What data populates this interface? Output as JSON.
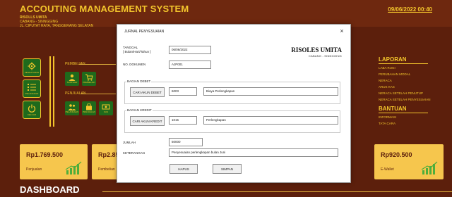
{
  "app": {
    "title": "ACCOUTING MANAGEMENT SYSTEM",
    "datetime": "09/06/2022 00:40",
    "business_name": "RISOLLS UMITA",
    "business_line2": "CABANG - SINNGGING",
    "business_address": "JL. CIPUTAT RAYA, TANGGERANG SELATAN"
  },
  "left_buttons": [
    {
      "label": "PENGATURAN"
    },
    {
      "label": "PELANGGAN"
    },
    {
      "label": "KELUAR"
    }
  ],
  "sections": {
    "pembelian": "PEMBELIAN",
    "penjualan": "PENJUALAN",
    "pembelian_items": [
      "SUPPLIER",
      "PEMBELIAN"
    ],
    "penjualan_items": [
      "PELANGGAN",
      "PENJUALAN",
      "KAS"
    ]
  },
  "right_panel": {
    "laporan_header": "LAPORAN",
    "laporan_items": [
      "LABA RUGI",
      "PERUBAHAN MODAL",
      "NERACA",
      "ARUS KAS",
      "NERACA SETELAH PENUTUP",
      "NERACA SETELAH PENYESUAIAN"
    ],
    "bantuan_header": "BANTUAN",
    "bantuan_items": [
      "INFORMASI",
      "TATA CARA"
    ]
  },
  "cards": [
    {
      "amount": "Rp1.769.500",
      "label": "Penjualan"
    },
    {
      "amount": "Rp2.852",
      "label": "Pembelian"
    },
    {
      "amount": "Rp920.500",
      "label": "E-Wallet"
    }
  ],
  "dashboard_title": "DASHBOARD",
  "dialog": {
    "title": "JURNAL PENYESUAIAN",
    "close": "×",
    "company_name": "RISOLES UMITA",
    "company_branch": "CABANG - SINNGGING",
    "tanggal_label": "TANGGAL",
    "tanggal_format": "[ Bulan/Hari/Tahun ]",
    "tanggal_value": "06/06/2022",
    "dokumen_label": "NO. DOKUMEN",
    "dokumen_value": "AJP001",
    "debet_group": "BAGIAN DEBET",
    "debet_button": "CARI AKUN DEBET",
    "debet_code": "6003",
    "debet_name": "Biaya Perlengkapan",
    "kredit_group": "BAGIAN KREDIT",
    "kredit_button": "CARI AKUN KREDIT",
    "kredit_code": "1015",
    "kredit_name": "Perlengkapan",
    "jumlah_label": "JUMLAH",
    "jumlah_value": "50000",
    "keterangan_label": "KETERANGAN",
    "keterangan_value": "Penyesuaian perlengkapan bulan Juni",
    "hapus_button": "HAPUS",
    "simpan_button": "SIMPAN"
  },
  "colors": {
    "background": "#5c1f0c",
    "accent": "#f3c52c",
    "button_green": "#1f6a1c",
    "card_yellow": "#f6c64d"
  }
}
